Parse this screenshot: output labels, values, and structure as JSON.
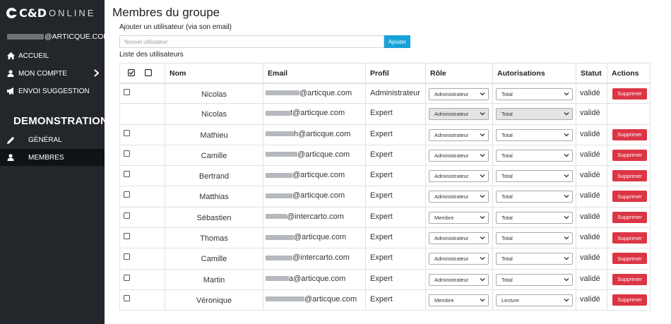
{
  "app": {
    "logo_cd": "C&D",
    "logo_online": "ONLINE",
    "user_email_suffix": "@ARTICQUE.COM",
    "accent_color": "#17a2d8",
    "sidebar_bg": "#23272c"
  },
  "sidebar": {
    "nav": [
      {
        "label": "ACCUEIL",
        "icon": "home-icon"
      },
      {
        "label": "MON COMPTE",
        "icon": "user-icon"
      },
      {
        "label": "ENVOI SUGGESTION",
        "icon": "megaphone-icon"
      }
    ],
    "section_title": "DEMONSTRATION",
    "sub_nav": [
      {
        "label": "GÉNÉRAL",
        "icon": "pencil-icon"
      },
      {
        "label": "MEMBRES",
        "icon": "user-icon"
      }
    ]
  },
  "main": {
    "title": "Membres du groupe",
    "add_label": "Ajouter un utilisateur (via son email)",
    "add_placeholder": "Nouvel utilisateur",
    "add_button": "Ajouter",
    "list_label": "Liste des utilisateurs",
    "columns": [
      "Nom",
      "Email",
      "Profil",
      "Rôle",
      "Autorisations",
      "Statut",
      "Actions"
    ],
    "delete_label": "Supprimer",
    "rows": [
      {
        "name": "Nicolas",
        "email_suffix": "@articque.com",
        "profil": "Administrateur",
        "role": "Administrateur",
        "autorisation": "Total",
        "statut": "validé",
        "checkbox": true,
        "deletable": true,
        "disabled": false
      },
      {
        "name": "Nicolas",
        "email_suffix": "t@articque.com",
        "profil": "Expert",
        "role": "Administrateur",
        "autorisation": "Total",
        "statut": "validé",
        "checkbox": false,
        "deletable": false,
        "disabled": true
      },
      {
        "name": "Mathieu",
        "email_suffix": "h@articque.com",
        "profil": "Expert",
        "role": "Administrateur",
        "autorisation": "Total",
        "statut": "validé",
        "checkbox": true,
        "deletable": true,
        "disabled": false
      },
      {
        "name": "Camille",
        "email_suffix": "@articque.com",
        "profil": "Expert",
        "role": "Administrateur",
        "autorisation": "Total",
        "statut": "validé",
        "checkbox": true,
        "deletable": true,
        "disabled": false
      },
      {
        "name": "Bertrand",
        "email_suffix": "@articque.com",
        "profil": "Expert",
        "role": "Administrateur",
        "autorisation": "Total",
        "statut": "validé",
        "checkbox": true,
        "deletable": true,
        "disabled": false
      },
      {
        "name": "Matthias",
        "email_suffix": "@articque.com",
        "profil": "Expert",
        "role": "Administrateur",
        "autorisation": "Total",
        "statut": "validé",
        "checkbox": true,
        "deletable": true,
        "disabled": false
      },
      {
        "name": "Sébastien",
        "email_suffix": "@intercarto.com",
        "profil": "Expert",
        "role": "Membre",
        "autorisation": "Total",
        "statut": "validé",
        "checkbox": true,
        "deletable": true,
        "disabled": false
      },
      {
        "name": "Thomas",
        "email_suffix": "@articque.com",
        "profil": "Expert",
        "role": "Administrateur",
        "autorisation": "Total",
        "statut": "validé",
        "checkbox": true,
        "deletable": true,
        "disabled": false
      },
      {
        "name": "Camille",
        "email_suffix": "@intercarto.com",
        "profil": "Expert",
        "role": "Administrateur",
        "autorisation": "Total",
        "statut": "validé",
        "checkbox": true,
        "deletable": true,
        "disabled": false
      },
      {
        "name": "Martin",
        "email_suffix": "a@articque.com",
        "profil": "Expert",
        "role": "Administrateur",
        "autorisation": "Total",
        "statut": "validé",
        "checkbox": true,
        "deletable": true,
        "disabled": false
      },
      {
        "name": "Véronique",
        "email_suffix": "@articque.com",
        "profil": "Expert",
        "role": "Membre",
        "autorisation": "Lecture",
        "statut": "validé",
        "checkbox": true,
        "deletable": true,
        "disabled": false
      }
    ]
  }
}
